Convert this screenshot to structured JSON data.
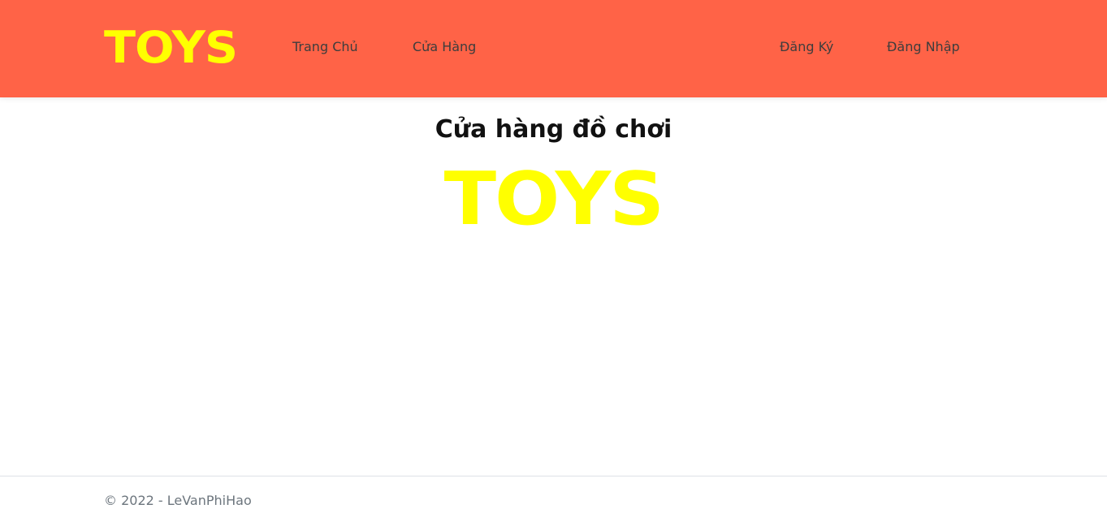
{
  "navbar": {
    "logo_text": "TOYS",
    "background_color": "#ff6347",
    "logo_color": "#ffff00",
    "links_left": [
      {
        "label": "Trang Chủ"
      },
      {
        "label": "Cửa Hàng"
      }
    ],
    "links_right": [
      {
        "label": "Đăng Ký"
      },
      {
        "label": "Đăng Nhập"
      }
    ]
  },
  "main": {
    "title": "Cửa hàng đồ chơi",
    "hero_logo_text": "TOYS"
  },
  "footer": {
    "copyright": "© 2022 - LeVanPhiHao"
  }
}
